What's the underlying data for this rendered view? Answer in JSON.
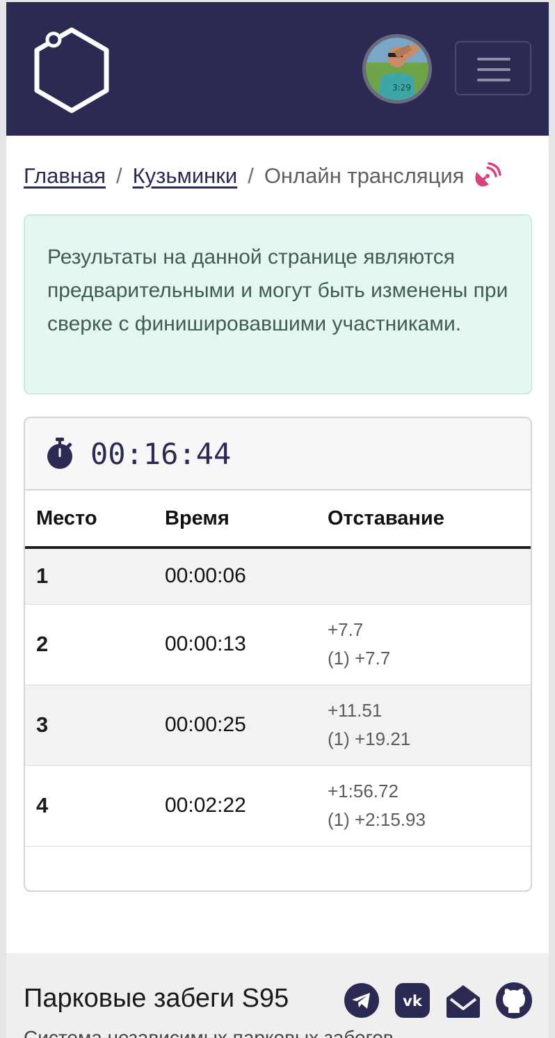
{
  "header": {
    "logo_icon": "hexagon-logo-icon",
    "avatar_icon": "user-avatar",
    "menu_icon": "hamburger-icon"
  },
  "breadcrumb": {
    "home": "Главная",
    "park": "Кузьминки",
    "current": "Онлайн трансляция",
    "separator": "/",
    "live_icon": "broadcast-icon",
    "live_color": "#d6437f"
  },
  "alert": {
    "text": "Результаты на данной странице являются предварительными и могут быть изменены при сверке с финишировавшими участниками."
  },
  "timer": {
    "icon": "stopwatch-icon",
    "value": "00:16:44"
  },
  "table": {
    "columns": [
      "Место",
      "Время",
      "Отставание"
    ],
    "rows": [
      {
        "place": "1",
        "time": "00:00:06",
        "gap": "",
        "gap_total": ""
      },
      {
        "place": "2",
        "time": "00:00:13",
        "gap": "+7.7",
        "gap_total": "(1) +7.7"
      },
      {
        "place": "3",
        "time": "00:00:25",
        "gap": "+11.51",
        "gap_total": "(1) +19.21"
      },
      {
        "place": "4",
        "time": "00:02:22",
        "gap": "+1:56.72",
        "gap_total": "(1) +2:15.93"
      }
    ]
  },
  "footer": {
    "title": "Парковые забеги S95",
    "subtitle": "Система независимых парковых забегов",
    "social": [
      "telegram-icon",
      "vk-icon",
      "mail-icon",
      "github-icon"
    ]
  },
  "colors": {
    "navbar": "#2b2a53",
    "alert_bg": "#e5f8f0",
    "alert_text": "#3e5e52"
  }
}
